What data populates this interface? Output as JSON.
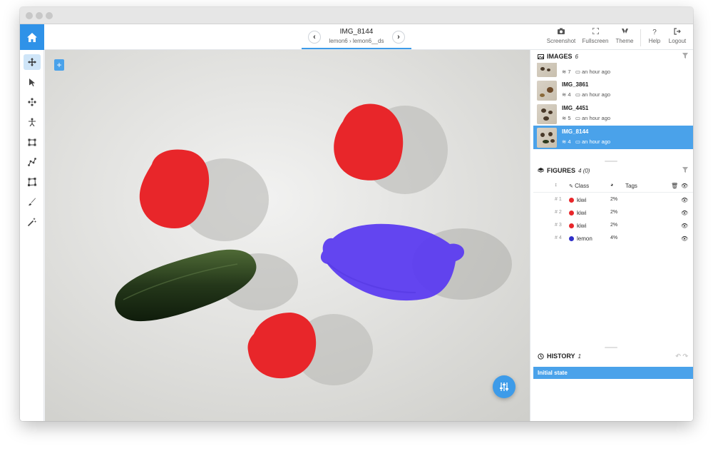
{
  "header": {
    "image_title": "IMG_8144",
    "path_project": "lemon6",
    "path_separator": "›",
    "path_dataset": "lemon6__ds",
    "prev_icon": "chevron-left-icon",
    "next_icon": "chevron-right-icon",
    "tools": [
      {
        "label": "Screenshot",
        "icon": "camera-icon"
      },
      {
        "label": "Fullscreen",
        "icon": "fullscreen-icon"
      },
      {
        "label": "Theme",
        "icon": "theme-icon"
      },
      {
        "label": "Help",
        "icon": "help-icon"
      },
      {
        "label": "Logout",
        "icon": "logout-icon"
      }
    ]
  },
  "left_tools": [
    {
      "name": "pan-tool",
      "active": true
    },
    {
      "name": "select-tool",
      "active": false
    },
    {
      "name": "points-tool",
      "active": false
    },
    {
      "name": "bitmap-tool",
      "active": false
    },
    {
      "name": "rectangle-tool",
      "active": false
    },
    {
      "name": "polyline-tool",
      "active": false
    },
    {
      "name": "polygon-tool",
      "active": false
    },
    {
      "name": "brush-tool",
      "active": false
    },
    {
      "name": "magic-wand-tool",
      "active": false
    }
  ],
  "canvas": {
    "add_label": "+"
  },
  "images": {
    "title": "IMAGES",
    "count": "6",
    "items": [
      {
        "name": "",
        "figures": "7",
        "time": "an hour ago",
        "selected": false
      },
      {
        "name": "IMG_3861",
        "figures": "4",
        "time": "an hour ago",
        "selected": false
      },
      {
        "name": "IMG_4451",
        "figures": "5",
        "time": "an hour ago",
        "selected": false
      },
      {
        "name": "IMG_8144",
        "figures": "4",
        "time": "an hour ago",
        "selected": true
      }
    ]
  },
  "figures": {
    "title": "FIGURES",
    "count": "4 (0)",
    "columns": {
      "class": "Class",
      "tags": "Tags"
    },
    "rows": [
      {
        "num": "# 1",
        "class": "kiwi",
        "color": "#e8262a",
        "area": "2%"
      },
      {
        "num": "# 2",
        "class": "kiwi",
        "color": "#e8262a",
        "area": "2%"
      },
      {
        "num": "# 3",
        "class": "kiwi",
        "color": "#e8262a",
        "area": "2%"
      },
      {
        "num": "# 4",
        "class": "lemon",
        "color": "#3030c8",
        "area": "4%"
      }
    ]
  },
  "history": {
    "title": "HISTORY",
    "count": "1",
    "items": [
      "Initial state"
    ]
  },
  "colors": {
    "accent": "#3d9be9",
    "kiwi": "#e8262a",
    "lemon": "#5c3cf0"
  }
}
